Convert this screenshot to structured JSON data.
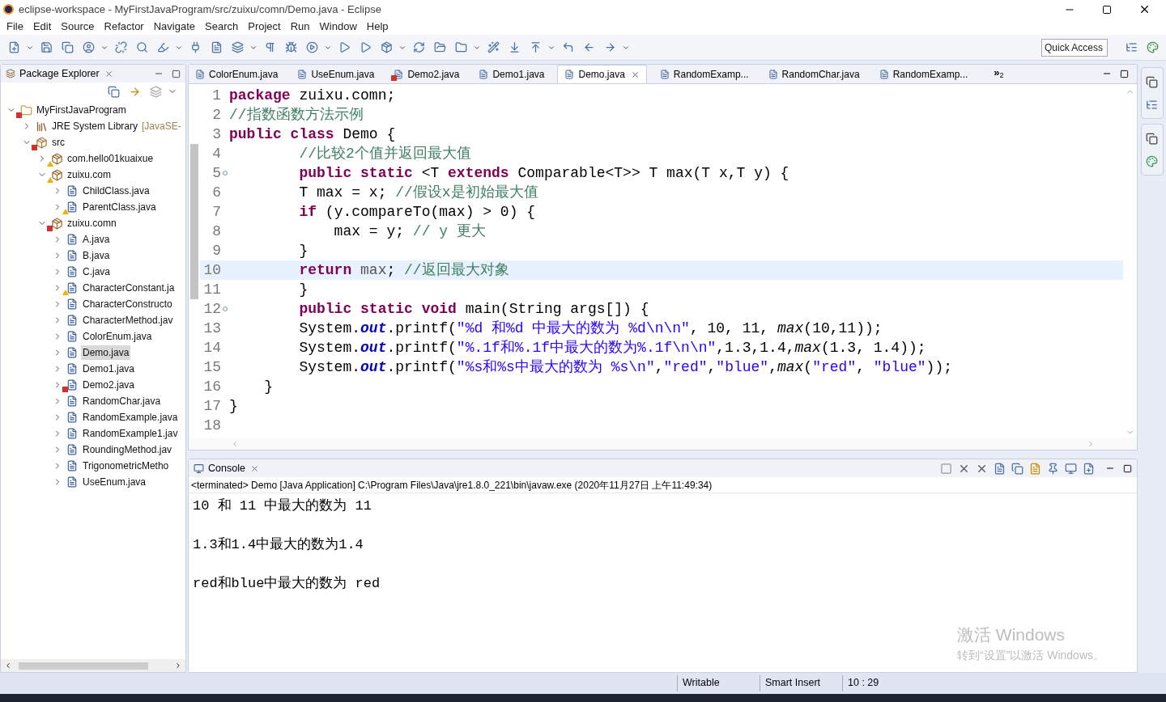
{
  "window": {
    "title": "eclipse-workspace - MyFirstJavaProgram/src/zuixu/comn/Demo.java - Eclipse"
  },
  "menu": [
    "File",
    "Edit",
    "Source",
    "Refactor",
    "Navigate",
    "Search",
    "Project",
    "Run",
    "Window",
    "Help"
  ],
  "quick_access": {
    "placeholder": "Quick Access"
  },
  "package_explorer": {
    "title": "Package Explorer",
    "tree": [
      {
        "label": "MyFirstJavaProgram",
        "kind": "project",
        "error": true,
        "warning": false,
        "expanded": true,
        "selected": false,
        "children": [
          {
            "label": "JRE System Library",
            "suffix": "[JavaSE-",
            "kind": "library",
            "error": false,
            "warning": false,
            "expanded": false,
            "selected": false
          },
          {
            "label": "src",
            "kind": "folder",
            "error": true,
            "warning": false,
            "expanded": true,
            "selected": false,
            "children": [
              {
                "label": "com.hello01kuaixue",
                "kind": "package",
                "error": false,
                "warning": true,
                "expanded": false,
                "selected": false
              },
              {
                "label": "zuixu.com",
                "kind": "package",
                "error": false,
                "warning": true,
                "expanded": true,
                "selected": false,
                "children": [
                  {
                    "label": "ChildClass.java",
                    "kind": "file",
                    "error": false,
                    "warning": false,
                    "expanded": false,
                    "selected": false
                  },
                  {
                    "label": "ParentClass.java",
                    "kind": "file",
                    "error": false,
                    "warning": true,
                    "expanded": false,
                    "selected": false
                  }
                ]
              },
              {
                "label": "zuixu.comn",
                "kind": "package",
                "error": true,
                "warning": false,
                "expanded": true,
                "selected": false,
                "children": [
                  {
                    "label": "A.java",
                    "kind": "file",
                    "error": false,
                    "warning": false,
                    "expanded": false,
                    "selected": false
                  },
                  {
                    "label": "B.java",
                    "kind": "file",
                    "error": false,
                    "warning": false,
                    "expanded": false,
                    "selected": false
                  },
                  {
                    "label": "C.java",
                    "kind": "file",
                    "error": false,
                    "warning": false,
                    "expanded": false,
                    "selected": false
                  },
                  {
                    "label": "CharacterConstant.ja",
                    "kind": "file",
                    "error": false,
                    "warning": true,
                    "expanded": false,
                    "selected": false
                  },
                  {
                    "label": "CharacterConstructo",
                    "kind": "file",
                    "error": false,
                    "warning": false,
                    "expanded": false,
                    "selected": false
                  },
                  {
                    "label": "CharacterMethod.jav",
                    "kind": "file",
                    "error": false,
                    "warning": false,
                    "expanded": false,
                    "selected": false
                  },
                  {
                    "label": "ColorEnum.java",
                    "kind": "file",
                    "error": false,
                    "warning": false,
                    "expanded": false,
                    "selected": false
                  },
                  {
                    "label": "Demo.java",
                    "kind": "file",
                    "error": false,
                    "warning": false,
                    "expanded": false,
                    "selected": true
                  },
                  {
                    "label": "Demo1.java",
                    "kind": "file",
                    "error": false,
                    "warning": false,
                    "expanded": false,
                    "selected": false
                  },
                  {
                    "label": "Demo2.java",
                    "kind": "file",
                    "error": true,
                    "warning": false,
                    "expanded": false,
                    "selected": false
                  },
                  {
                    "label": "RandomChar.java",
                    "kind": "file",
                    "error": false,
                    "warning": false,
                    "expanded": false,
                    "selected": false
                  },
                  {
                    "label": "RandomExample.java",
                    "kind": "file",
                    "error": false,
                    "warning": false,
                    "expanded": false,
                    "selected": false
                  },
                  {
                    "label": "RandomExample1.jav",
                    "kind": "file",
                    "error": false,
                    "warning": false,
                    "expanded": false,
                    "selected": false
                  },
                  {
                    "label": "RoundingMethod.jav",
                    "kind": "file",
                    "error": false,
                    "warning": false,
                    "expanded": false,
                    "selected": false
                  },
                  {
                    "label": "TrigonometricMetho",
                    "kind": "file",
                    "error": false,
                    "warning": false,
                    "expanded": false,
                    "selected": false
                  },
                  {
                    "label": "UseEnum.java",
                    "kind": "file",
                    "error": false,
                    "warning": false,
                    "expanded": false,
                    "selected": false
                  }
                ]
              }
            ]
          }
        ]
      }
    ]
  },
  "editor_tabs": [
    {
      "label": "ColorEnum.java",
      "selected": false,
      "error": false
    },
    {
      "label": "UseEnum.java",
      "selected": false,
      "error": false
    },
    {
      "label": "Demo2.java",
      "selected": false,
      "error": true
    },
    {
      "label": "Demo1.java",
      "selected": false,
      "error": false
    },
    {
      "label": "Demo.java",
      "selected": true,
      "error": false
    },
    {
      "label": "RandomExamp...",
      "selected": false,
      "error": false
    },
    {
      "label": "RandomChar.java",
      "selected": false,
      "error": false
    },
    {
      "label": "RandomExamp...",
      "selected": false,
      "error": false
    }
  ],
  "tab_overflow": "»",
  "tab_overflow_count": "2",
  "code": [
    {
      "number": "1",
      "current": false,
      "fold": false,
      "tokens": [
        {
          "kind": "keyword",
          "text": "package"
        },
        {
          "kind": "plain",
          "text": " zuixu.comn;"
        }
      ]
    },
    {
      "number": "2",
      "current": false,
      "fold": false,
      "tokens": [
        {
          "kind": "comment",
          "text": "//指数函数方法示例"
        }
      ]
    },
    {
      "number": "3",
      "current": false,
      "fold": false,
      "tokens": [
        {
          "kind": "keyword",
          "text": "public class"
        },
        {
          "kind": "plain",
          "text": " Demo {"
        }
      ]
    },
    {
      "number": "4",
      "current": false,
      "fold": false,
      "tokens": [
        {
          "kind": "comment",
          "text": "        //比较2个值并返回最大值"
        }
      ]
    },
    {
      "number": "5",
      "current": false,
      "fold": true,
      "tokens": [
        {
          "kind": "keyword",
          "text": "        public static"
        },
        {
          "kind": "plain",
          "text": " <T "
        },
        {
          "kind": "keyword",
          "text": "extends"
        },
        {
          "kind": "plain",
          "text": " Comparable<T>> T max(T x,T y) {"
        }
      ]
    },
    {
      "number": "6",
      "current": false,
      "fold": false,
      "tokens": [
        {
          "kind": "plain",
          "text": "        T max = x; "
        },
        {
          "kind": "comment",
          "text": "//假设x是初始最大值"
        }
      ]
    },
    {
      "number": "7",
      "current": false,
      "fold": false,
      "tokens": [
        {
          "kind": "keyword",
          "text": "        if"
        },
        {
          "kind": "plain",
          "text": " (y.compareTo(max) > 0) {"
        }
      ]
    },
    {
      "number": "8",
      "current": false,
      "fold": false,
      "tokens": [
        {
          "kind": "plain",
          "text": "            max = y; "
        },
        {
          "kind": "comment",
          "text": "// y 更大"
        }
      ]
    },
    {
      "number": "9",
      "current": false,
      "fold": false,
      "tokens": [
        {
          "kind": "plain",
          "text": "        }"
        }
      ]
    },
    {
      "number": "10",
      "current": true,
      "fold": false,
      "tokens": [
        {
          "kind": "keyword",
          "text": "        return"
        },
        {
          "kind": "occurrence",
          "text": " max"
        },
        {
          "kind": "plain",
          "text": "; "
        },
        {
          "kind": "comment",
          "text": "//返回最大对象"
        }
      ]
    },
    {
      "number": "11",
      "current": false,
      "fold": false,
      "tokens": [
        {
          "kind": "plain",
          "text": "        }"
        }
      ]
    },
    {
      "number": "12",
      "current": false,
      "fold": true,
      "tokens": [
        {
          "kind": "keyword",
          "text": "        public static void"
        },
        {
          "kind": "plain",
          "text": " main(String args[]) {"
        }
      ]
    },
    {
      "number": "13",
      "current": false,
      "fold": false,
      "tokens": [
        {
          "kind": "plain",
          "text": "        System."
        },
        {
          "kind": "field",
          "text": "out"
        },
        {
          "kind": "plain",
          "text": ".printf("
        },
        {
          "kind": "string",
          "text": "\"%d 和%d 中最大的数为 %d\\n\\n\""
        },
        {
          "kind": "plain",
          "text": ", 10, 11, "
        },
        {
          "kind": "static",
          "text": "max"
        },
        {
          "kind": "plain",
          "text": "(10,11));"
        }
      ]
    },
    {
      "number": "14",
      "current": false,
      "fold": false,
      "tokens": [
        {
          "kind": "plain",
          "text": "        System."
        },
        {
          "kind": "field",
          "text": "out"
        },
        {
          "kind": "plain",
          "text": ".printf("
        },
        {
          "kind": "string",
          "text": "\"%.1f和%.1f中最大的数为%.1f\\n\\n\""
        },
        {
          "kind": "plain",
          "text": ",1.3,1.4,"
        },
        {
          "kind": "static",
          "text": "max"
        },
        {
          "kind": "plain",
          "text": "(1.3, 1.4));"
        }
      ]
    },
    {
      "number": "15",
      "current": false,
      "fold": false,
      "tokens": [
        {
          "kind": "plain",
          "text": "        System."
        },
        {
          "kind": "field",
          "text": "out"
        },
        {
          "kind": "plain",
          "text": ".printf("
        },
        {
          "kind": "string",
          "text": "\"%s和%s中最大的数为 %s\\n\""
        },
        {
          "kind": "plain",
          "text": ","
        },
        {
          "kind": "string",
          "text": "\"red\""
        },
        {
          "kind": "plain",
          "text": ","
        },
        {
          "kind": "string",
          "text": "\"blue\""
        },
        {
          "kind": "plain",
          "text": ","
        },
        {
          "kind": "static",
          "text": "max"
        },
        {
          "kind": "plain",
          "text": "("
        },
        {
          "kind": "string",
          "text": "\"red\""
        },
        {
          "kind": "plain",
          "text": ", "
        },
        {
          "kind": "string",
          "text": "\"blue\""
        },
        {
          "kind": "plain",
          "text": "));"
        }
      ]
    },
    {
      "number": "16",
      "current": false,
      "fold": false,
      "tokens": [
        {
          "kind": "plain",
          "text": "    }"
        }
      ]
    },
    {
      "number": "17",
      "current": false,
      "fold": false,
      "tokens": [
        {
          "kind": "plain",
          "text": "}"
        }
      ]
    },
    {
      "number": "18",
      "current": false,
      "fold": false
    }
  ],
  "console": {
    "title": "Console",
    "status": "<terminated> Demo [Java Application] C:\\Program Files\\Java\\jre1.8.0_221\\bin\\javaw.exe (2020年11月27日 上午11:49:34)",
    "output": [
      "10 和 11 中最大的数为 11",
      "1.3和1.4中最大的数为1.4",
      "red和blue中最大的数为 red"
    ]
  },
  "activation": {
    "title": "激活 Windows",
    "hint": "转到“设置”以激活 Windows。"
  },
  "status_bar": [
    "Writable",
    "Smart Insert",
    "10 : 29"
  ]
}
